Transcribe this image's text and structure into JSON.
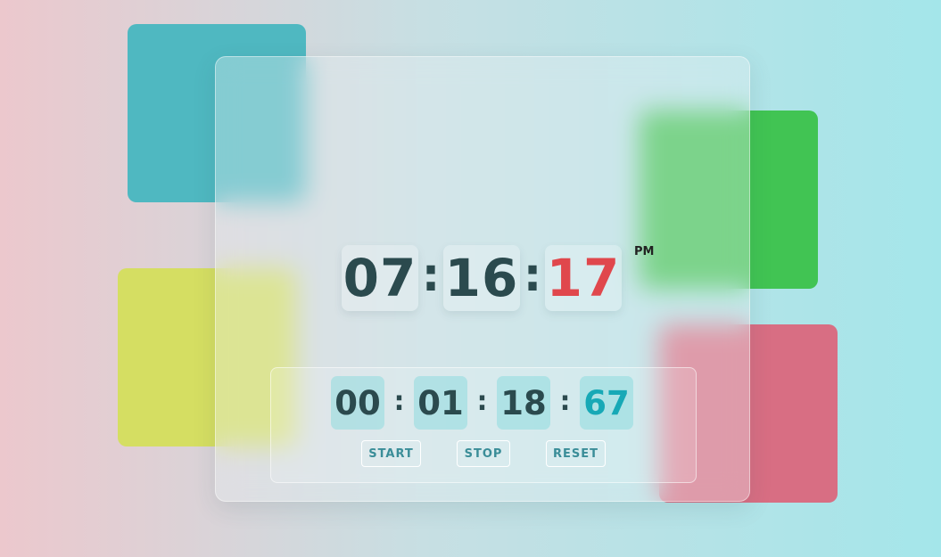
{
  "clock": {
    "hours": "07",
    "minutes": "16",
    "seconds": "17",
    "separator": ":",
    "period": "PM"
  },
  "stopwatch": {
    "hours": "00",
    "minutes": "01",
    "seconds": "18",
    "centiseconds": "67",
    "separator": ":",
    "buttons": {
      "start": "START",
      "stop": "STOP",
      "reset": "RESET"
    }
  },
  "colors": {
    "seconds_accent": "#e0474c",
    "centiseconds_accent": "#17a9b6",
    "block_cyan": "#4fb8c1",
    "block_yellow": "#d5de62",
    "block_green": "#41c453",
    "block_pink": "#d86e83"
  }
}
